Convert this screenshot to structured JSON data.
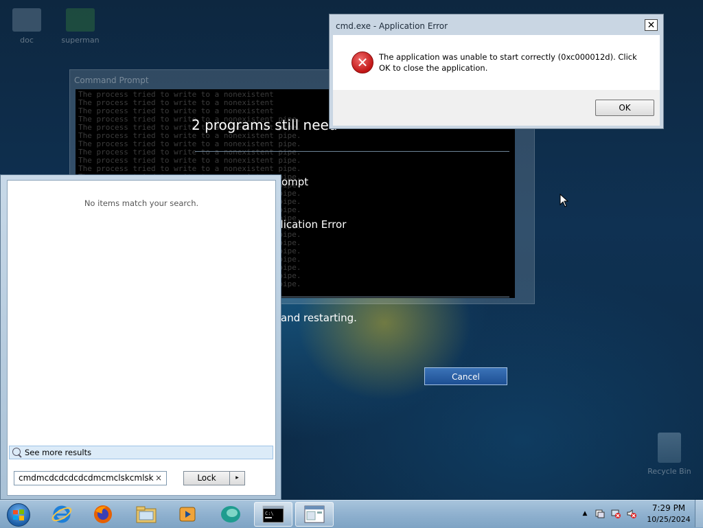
{
  "desktop": {
    "icons": [
      {
        "label": "doc"
      },
      {
        "label": "superman"
      },
      {
        "label": "Recycle Bin"
      }
    ]
  },
  "background_window": {
    "title": "Command Prompt",
    "console_lines": [
      "The process tried to write to a nonexistent",
      "The process tried to write to a nonexistent",
      "The process tried to write to a nonexistent",
      "The process tried to write to a nonexistent pipe.",
      "The process tried to write to a nonexistent pipe.",
      "The process tried to write to a nonexistent pipe.",
      "The process tried to write to a nonexistent pipe.",
      "The process tried to write to a nonexistent pipe.",
      "The process tried to write to a nonexistent pipe.",
      "The process tried to write to a nonexistent pipe.",
      "The process tried to write to a nonexistent pipe.",
      "The process tried to write to a nonexistent pipe.",
      "The process tried to write to a nonexistent pipe.",
      "The process tried to write to a nonexistent pipe.",
      "The process tried to write to a nonexistent pipe.",
      "The process tried to write to a nonexistent pipe.",
      "The process tried to write to a nonexistent pipe.",
      "The process tried to write to a nonexistent pipe.",
      "The process tried to write to a nonexistent pipe.",
      "The process tried to write to a nonexistent pipe.",
      "The process tried to write to a nonexistent pipe.",
      "The process tried to write to a nonexistent pipe.",
      "The process tried to write to a nonexistent pipe.",
      "The process tried to write to a nonexistent pipe."
    ]
  },
  "shutdown_screen": {
    "title": "2 programs still need",
    "program_1": "ompt",
    "program_2": "plication Error",
    "message": "and restarting.",
    "cancel_label": "Cancel"
  },
  "error_dialog": {
    "title": "cmd.exe - Application Error",
    "close_label": "✕",
    "message": "The application was unable to start correctly (0xc000012d). Click OK to close the application.",
    "ok_label": "OK",
    "icon": "error-icon"
  },
  "start_menu": {
    "no_results_text": "No items match your search.",
    "see_more_label": "See more results",
    "search_value": "cmdmcdcdcdcdcdmcmclskcmlsk",
    "clear_label": "×",
    "lock_label": "Lock",
    "lock_arrow": "▸"
  },
  "taskbar": {
    "pinned": [
      "internet-explorer-icon",
      "firefox-icon",
      "file-explorer-icon",
      "media-player-icon",
      "chat-app-icon",
      "command-prompt-icon",
      "application-window-icon"
    ],
    "tray_arrow": "▲",
    "clock_time": "7:29 PM",
    "clock_date": "10/25/2024"
  }
}
